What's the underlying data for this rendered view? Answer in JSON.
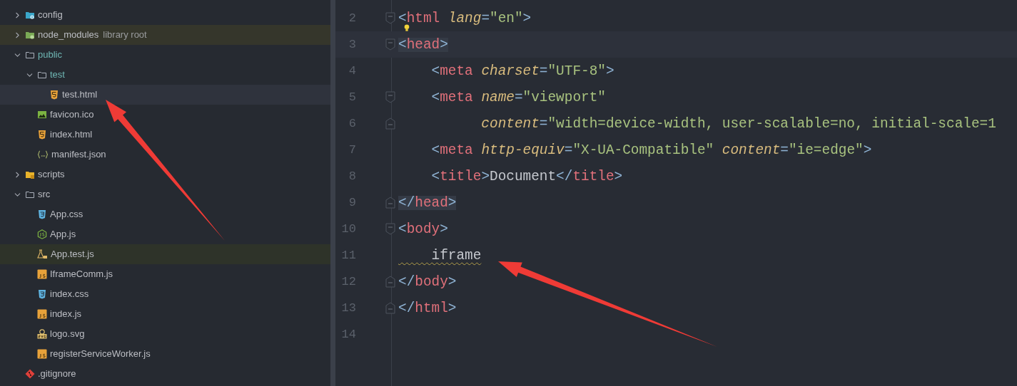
{
  "project_tree": [
    {
      "name": "config",
      "kind": "folder-config",
      "added": false,
      "expanded": false,
      "selected": false
    },
    {
      "name": "node_modules",
      "suffix": "library root",
      "kind": "folder-lib",
      "added": false,
      "expanded": false,
      "selected": false,
      "color": "#35362b"
    },
    {
      "name": "public",
      "kind": "folder",
      "added": true,
      "expanded": true,
      "selected": false,
      "children": [
        {
          "name": "test",
          "kind": "folder",
          "added": true,
          "expanded": true,
          "selected": false,
          "children": [
            {
              "name": "test.html",
              "kind": "html",
              "added": false,
              "selected": true
            }
          ]
        },
        {
          "name": "favicon.ico",
          "kind": "image",
          "added": false,
          "selected": false
        },
        {
          "name": "index.html",
          "kind": "html",
          "added": false,
          "selected": false
        },
        {
          "name": "manifest.json",
          "kind": "json",
          "added": false,
          "selected": false
        }
      ]
    },
    {
      "name": "scripts",
      "kind": "folder-js",
      "added": false,
      "expanded": false,
      "selected": false
    },
    {
      "name": "src",
      "kind": "folder",
      "added": false,
      "expanded": true,
      "selected": false,
      "children": [
        {
          "name": "App.css",
          "kind": "css",
          "added": false,
          "selected": false
        },
        {
          "name": "App.js",
          "kind": "nodejs",
          "added": false,
          "selected": false
        },
        {
          "name": "App.test.js",
          "kind": "test-js",
          "added": false,
          "selected": false,
          "color": "#2e3329"
        },
        {
          "name": "IframeComm.js",
          "kind": "js",
          "added": false,
          "selected": false
        },
        {
          "name": "index.css",
          "kind": "css",
          "added": false,
          "selected": false
        },
        {
          "name": "index.js",
          "kind": "js",
          "added": false,
          "selected": false
        },
        {
          "name": "logo.svg",
          "kind": "svg",
          "added": false,
          "selected": false
        },
        {
          "name": "registerServiceWorker.js",
          "kind": "js",
          "added": false,
          "selected": false
        }
      ]
    },
    {
      "name": ".gitignore",
      "kind": "git",
      "added": false,
      "selected": false
    }
  ],
  "editor": {
    "lines": [
      {
        "number": "2",
        "fold_start": true,
        "fold_end": false,
        "current": false,
        "matched": false,
        "intention": true,
        "tokens": [
          {
            "kind": "punct",
            "text": "<"
          },
          {
            "kind": "tag",
            "text": "html "
          },
          {
            "kind": "attr",
            "text": "lang"
          },
          {
            "kind": "punct",
            "text": "="
          },
          {
            "kind": "string",
            "text": "\"en\""
          },
          {
            "kind": "punct",
            "text": ">"
          }
        ]
      },
      {
        "number": "3",
        "fold_start": true,
        "fold_end": false,
        "current": true,
        "matched": true,
        "intention": false,
        "tokens": [
          {
            "kind": "punct",
            "text": "<"
          },
          {
            "kind": "tag",
            "text": "head"
          },
          {
            "kind": "punct",
            "text": ">"
          }
        ]
      },
      {
        "number": "4",
        "fold_start": false,
        "fold_end": false,
        "current": false,
        "matched": false,
        "intention": false,
        "tokens": [
          {
            "kind": "punct",
            "text": "    <"
          },
          {
            "kind": "tag",
            "text": "meta "
          },
          {
            "kind": "attr",
            "text": "charset"
          },
          {
            "kind": "punct",
            "text": "="
          },
          {
            "kind": "string",
            "text": "\"UTF-8\""
          },
          {
            "kind": "punct",
            "text": ">"
          }
        ]
      },
      {
        "number": "5",
        "fold_start": true,
        "fold_end": false,
        "current": false,
        "matched": false,
        "intention": false,
        "tokens": [
          {
            "kind": "punct",
            "text": "    <"
          },
          {
            "kind": "tag",
            "text": "meta "
          },
          {
            "kind": "attr",
            "text": "name"
          },
          {
            "kind": "punct",
            "text": "="
          },
          {
            "kind": "string",
            "text": "\"viewport\""
          }
        ]
      },
      {
        "number": "6",
        "fold_start": false,
        "fold_end": true,
        "current": false,
        "matched": false,
        "intention": false,
        "tokens": [
          {
            "kind": "attr",
            "text": "          content"
          },
          {
            "kind": "punct",
            "text": "="
          },
          {
            "kind": "string",
            "text": "\"width=device-width, user-scalable=no, initial-scale=1"
          }
        ]
      },
      {
        "number": "7",
        "fold_start": false,
        "fold_end": false,
        "current": false,
        "matched": false,
        "intention": false,
        "tokens": [
          {
            "kind": "punct",
            "text": "    <"
          },
          {
            "kind": "tag",
            "text": "meta "
          },
          {
            "kind": "attr",
            "text": "http-equiv"
          },
          {
            "kind": "punct",
            "text": "="
          },
          {
            "kind": "string",
            "text": "\"X-UA-Compatible\" "
          },
          {
            "kind": "attr",
            "text": "content"
          },
          {
            "kind": "punct",
            "text": "="
          },
          {
            "kind": "string",
            "text": "\"ie=edge\""
          },
          {
            "kind": "punct",
            "text": ">"
          }
        ]
      },
      {
        "number": "8",
        "fold_start": false,
        "fold_end": false,
        "current": false,
        "matched": false,
        "intention": false,
        "tokens": [
          {
            "kind": "punct",
            "text": "    <"
          },
          {
            "kind": "tag",
            "text": "title"
          },
          {
            "kind": "punct",
            "text": ">"
          },
          {
            "kind": "text",
            "text": "Document"
          },
          {
            "kind": "punct",
            "text": "</"
          },
          {
            "kind": "tag",
            "text": "title"
          },
          {
            "kind": "punct",
            "text": ">"
          }
        ]
      },
      {
        "number": "9",
        "fold_start": false,
        "fold_end": true,
        "current": false,
        "matched": true,
        "intention": false,
        "tokens": [
          {
            "kind": "punct",
            "text": "</"
          },
          {
            "kind": "tag",
            "text": "head"
          },
          {
            "kind": "punct",
            "text": ">"
          }
        ]
      },
      {
        "number": "10",
        "fold_start": true,
        "fold_end": false,
        "current": false,
        "matched": false,
        "intention": false,
        "tokens": [
          {
            "kind": "punct",
            "text": "<"
          },
          {
            "kind": "tag",
            "text": "body"
          },
          {
            "kind": "punct",
            "text": ">"
          }
        ]
      },
      {
        "number": "11",
        "fold_start": false,
        "fold_end": false,
        "current": false,
        "matched": false,
        "intention": false,
        "tokens": [
          {
            "kind": "text",
            "text": "    iframe",
            "warning": true
          }
        ]
      },
      {
        "number": "12",
        "fold_start": false,
        "fold_end": true,
        "current": false,
        "matched": false,
        "intention": false,
        "tokens": [
          {
            "kind": "punct",
            "text": "</"
          },
          {
            "kind": "tag",
            "text": "body"
          },
          {
            "kind": "punct",
            "text": ">"
          }
        ]
      },
      {
        "number": "13",
        "fold_start": false,
        "fold_end": true,
        "current": false,
        "matched": false,
        "intention": false,
        "tokens": [
          {
            "kind": "punct",
            "text": "</"
          },
          {
            "kind": "tag",
            "text": "html"
          },
          {
            "kind": "punct",
            "text": ">"
          }
        ]
      },
      {
        "number": "14",
        "fold_start": false,
        "fold_end": false,
        "current": false,
        "matched": false,
        "intention": false
      }
    ]
  }
}
